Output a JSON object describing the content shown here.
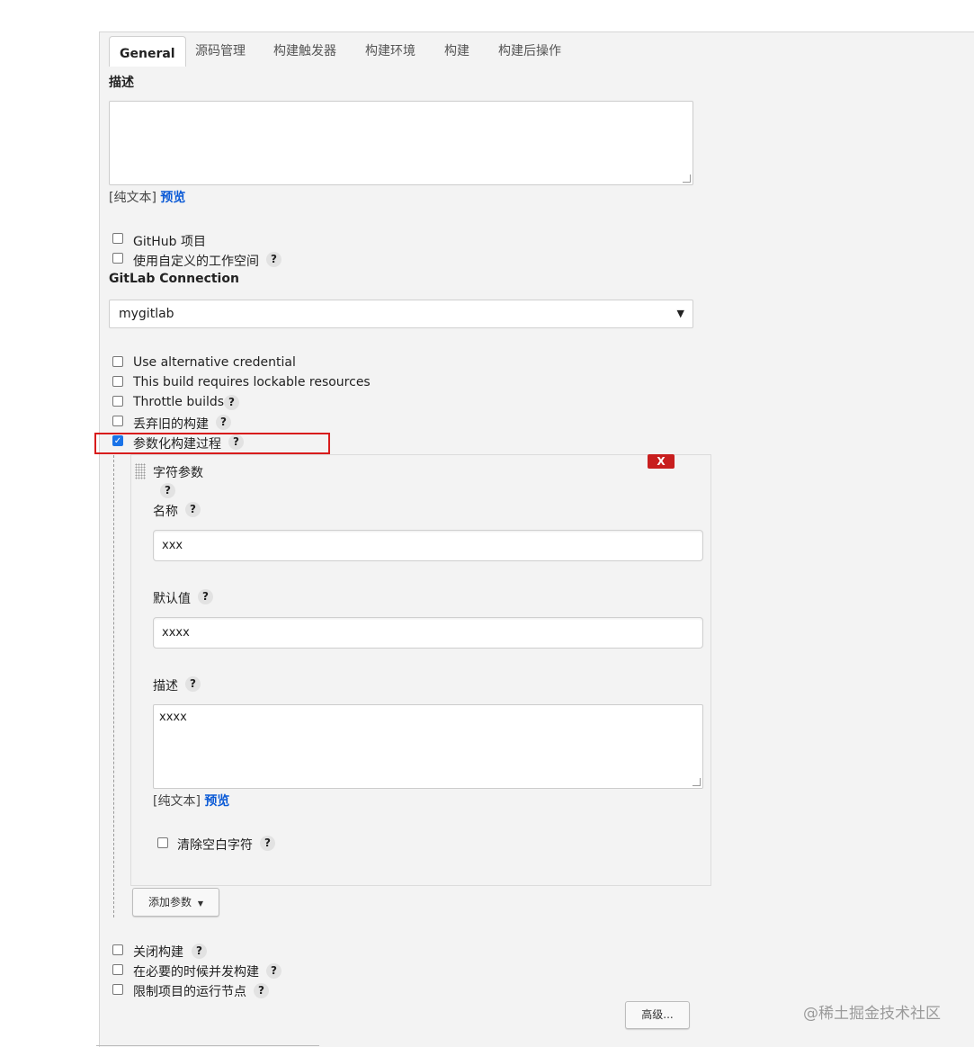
{
  "tabs": [
    {
      "label": "General"
    },
    {
      "label": "源码管理"
    },
    {
      "label": "构建触发器"
    },
    {
      "label": "构建环境"
    },
    {
      "label": "构建"
    },
    {
      "label": "构建后操作"
    }
  ],
  "description": {
    "label": "描述",
    "value": "",
    "format_label": "[纯文本]",
    "preview_link": "预览"
  },
  "checkboxes_top": [
    {
      "label": "GitHub 项目",
      "checked": false,
      "help": false
    },
    {
      "label": "使用自定义的工作空间",
      "checked": false,
      "help": true
    }
  ],
  "gitlab": {
    "label": "GitLab Connection",
    "selected": "mygitlab"
  },
  "checkboxes_mid": [
    {
      "label": "Use alternative credential",
      "checked": false
    },
    {
      "label": "This build requires lockable resources",
      "checked": false
    },
    {
      "label": "Throttle builds",
      "checked": false
    },
    {
      "label": "丢弃旧的构建",
      "checked": false
    },
    {
      "label": "参数化构建过程",
      "checked": true
    }
  ],
  "help_glyph": "?",
  "param": {
    "type_label": "字符参数",
    "delete_label": "X",
    "name_label": "名称",
    "name_value": "xxx",
    "default_label": "默认值",
    "default_value": "xxxx",
    "desc_label": "描述",
    "desc_value": "xxxx",
    "format_label": "[纯文本]",
    "preview_link": "预览",
    "trim_label": "清除空白字符"
  },
  "add_param_button": "添加参数",
  "checkboxes_bottom": [
    {
      "label": "关闭构建",
      "checked": false
    },
    {
      "label": "在必要的时候并发构建",
      "checked": false
    },
    {
      "label": "限制项目的运行节点",
      "checked": false
    }
  ],
  "advanced_button": "高级...",
  "watermark": "@稀土掘金技术社区",
  "colors": {
    "highlight": "#d81c1c",
    "link": "#0b5ad6",
    "delete": "#c81e1e",
    "checkbox_checked": "#1a73e8"
  }
}
